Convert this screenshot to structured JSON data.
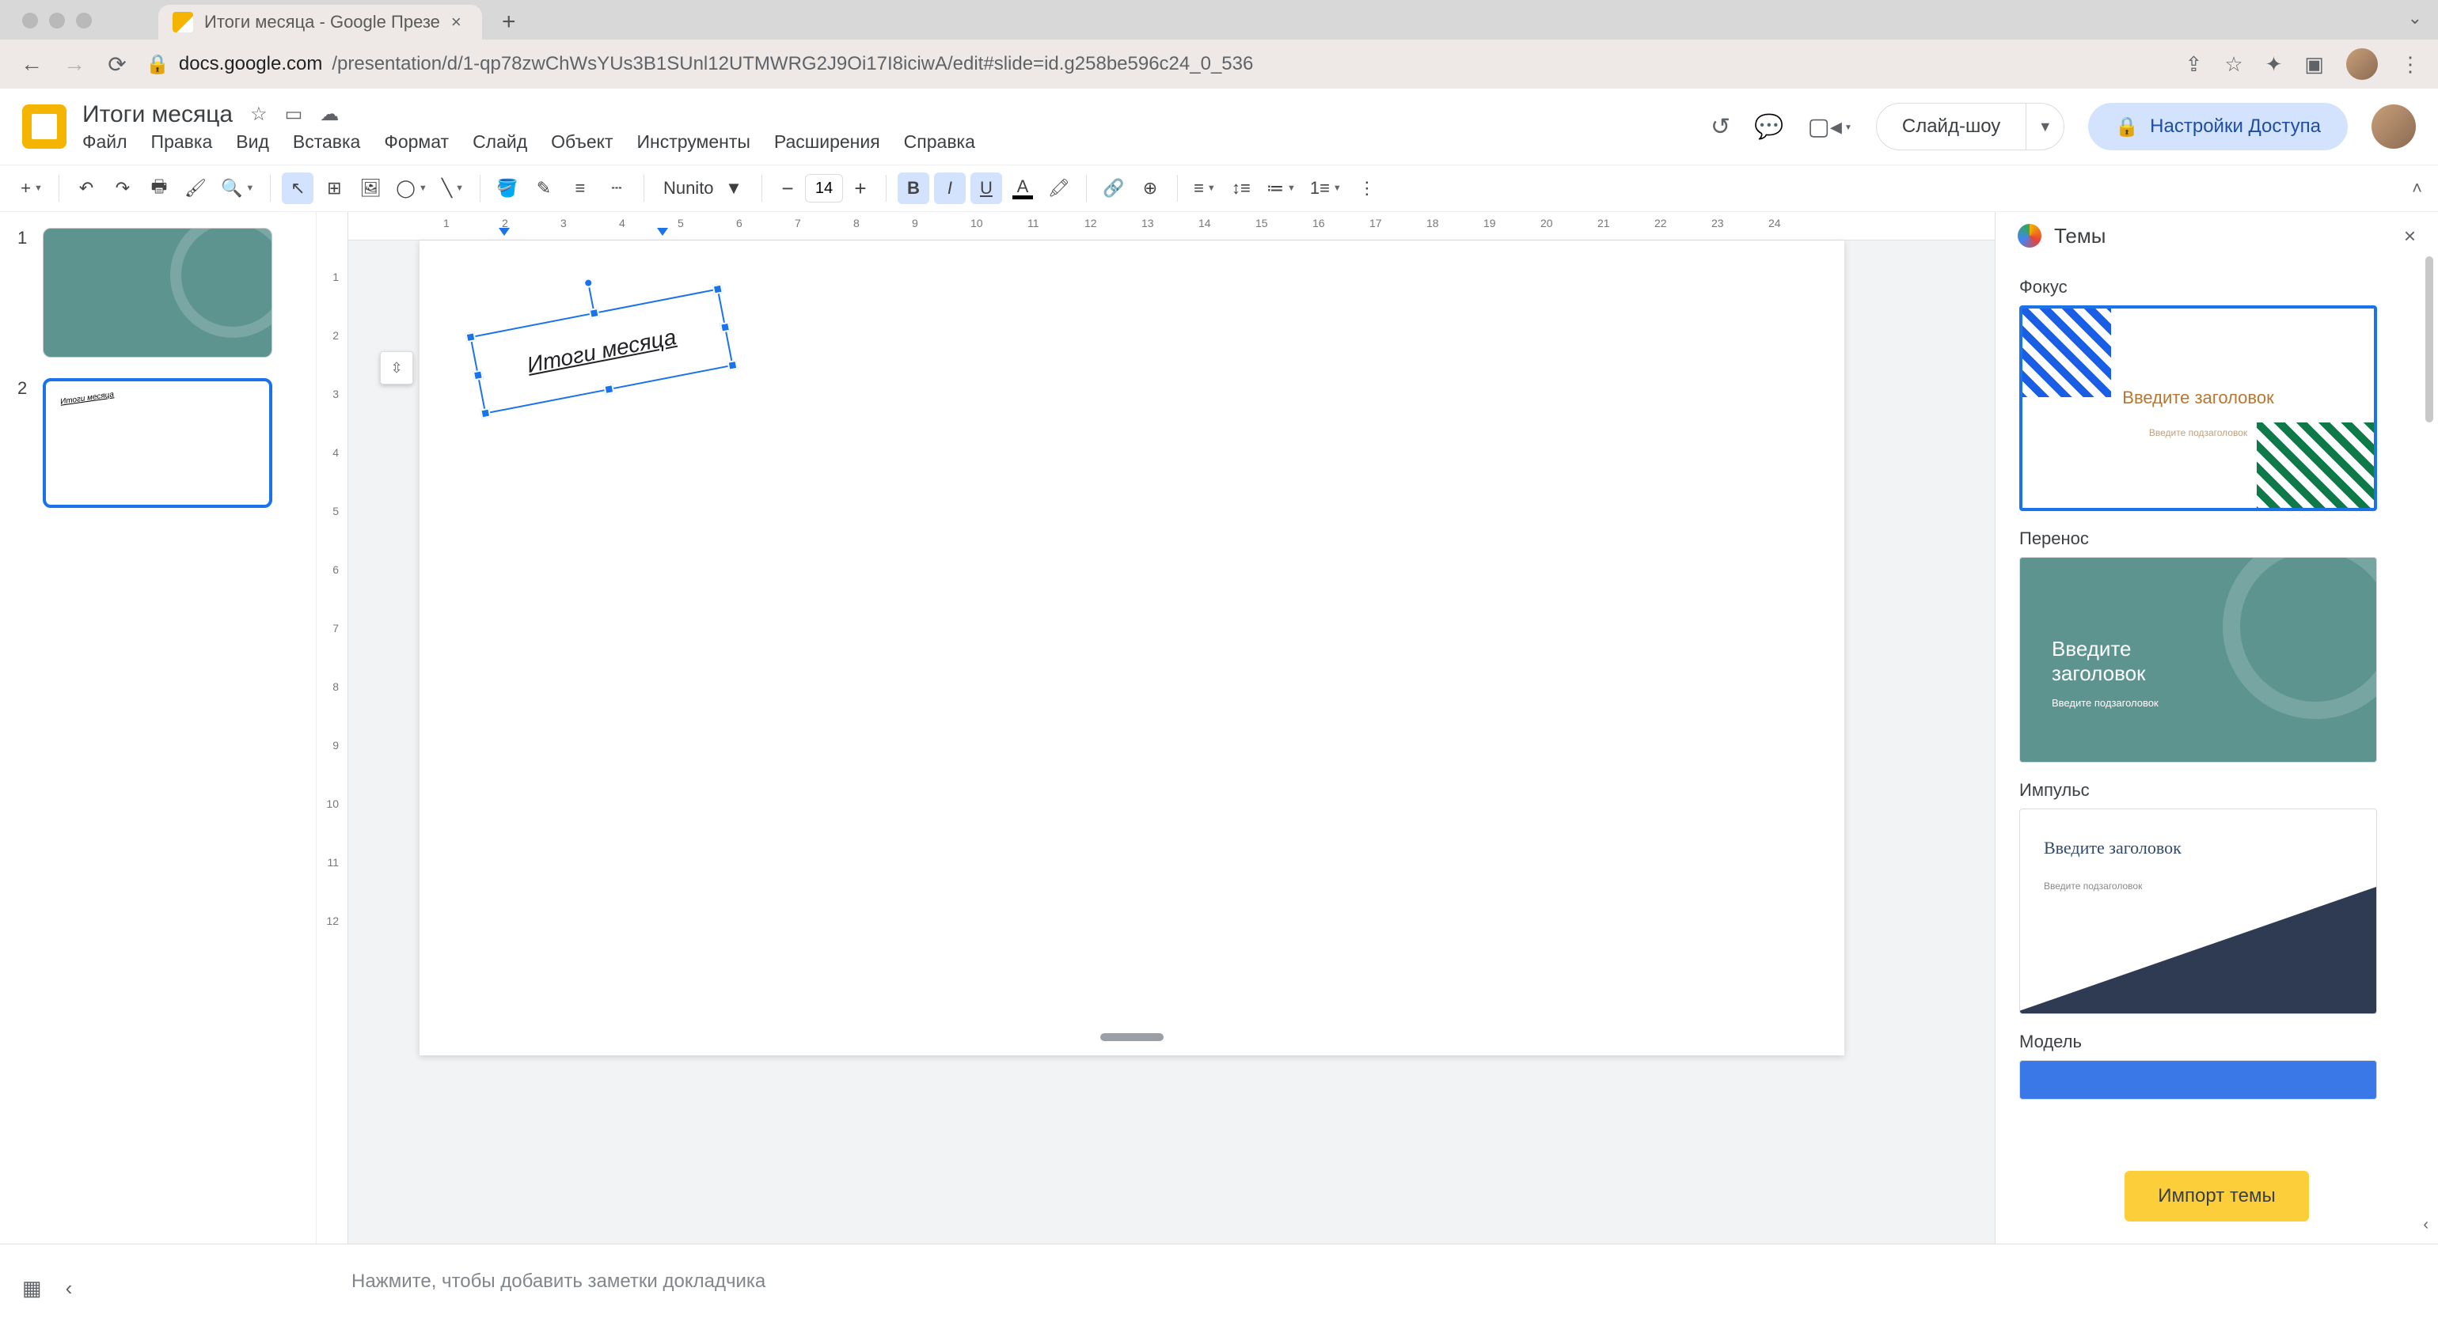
{
  "browser": {
    "tab_title": "Итоги месяца - Google Презе",
    "url_host": "docs.google.com",
    "url_path": "/presentation/d/1-qp78zwChWsYUs3B1SUnl12UTMWRG2J9Oi17I8iciwA/edit#slide=id.g258be596c24_0_536"
  },
  "title": {
    "doc_name": "Итоги месяца",
    "slideshow": "Слайд-шоу",
    "share": "Настройки Доступа"
  },
  "menu": [
    "Файл",
    "Правка",
    "Вид",
    "Вставка",
    "Формат",
    "Слайд",
    "Объект",
    "Инструменты",
    "Расширения",
    "Справка"
  ],
  "toolbar": {
    "font": "Nunito",
    "font_size": "14"
  },
  "ruler_h": [
    1,
    2,
    3,
    4,
    5,
    6,
    7,
    8,
    9,
    10,
    11,
    12,
    13,
    14,
    15,
    16,
    17,
    18,
    19,
    20,
    21,
    22,
    23,
    24
  ],
  "ruler_v": [
    1,
    2,
    3,
    4,
    5,
    6,
    7,
    8,
    9,
    10,
    11,
    12
  ],
  "filmstrip": [
    {
      "num": "1",
      "selected": false
    },
    {
      "num": "2",
      "selected": true
    }
  ],
  "slide": {
    "textbox_content": "Итоги месяца"
  },
  "speaker_notes_placeholder": "Нажмите, чтобы добавить заметки докладчика",
  "themes": {
    "panel_title": "Темы",
    "items": [
      {
        "name": "Фокус",
        "title": "Введите заголовок",
        "subtitle": "Введите подзаголовок",
        "selected": true
      },
      {
        "name": "Перенос",
        "title": "Введите заголовок",
        "subtitle": "Введите подзаголовок",
        "selected": false
      },
      {
        "name": "Импульс",
        "title": "Введите заголовок",
        "subtitle": "Введите подзаголовок",
        "selected": false
      },
      {
        "name": "Модель",
        "title": "",
        "subtitle": "",
        "selected": false
      }
    ],
    "import_label": "Импорт темы"
  }
}
